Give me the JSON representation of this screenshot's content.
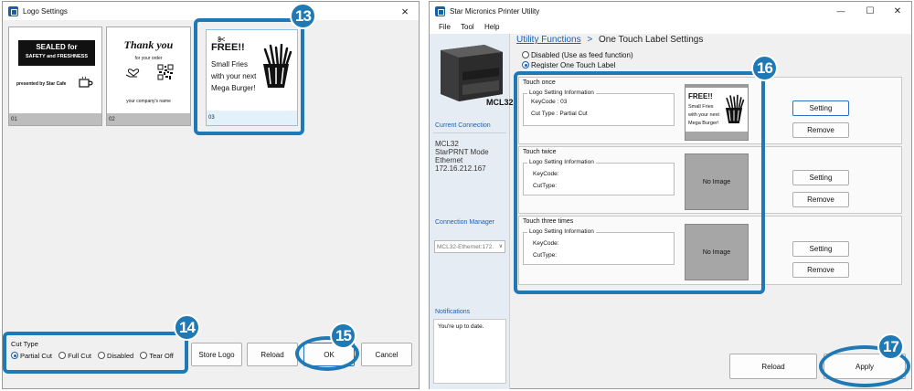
{
  "logo_window": {
    "title": "Logo Settings",
    "close": "×",
    "thumbnails": [
      {
        "index": "01",
        "line1": "SEALED for",
        "line2": "SAFETY and FRESHNESS",
        "line3": "presented by Star Cafe"
      },
      {
        "index": "02",
        "line1": "Thank you",
        "line2": "for your order",
        "line3": "your company's name"
      },
      {
        "index": "03",
        "line1": "FREE!!",
        "line2": "Small Fries",
        "line3": "with your next",
        "line4": "Mega Burger!"
      }
    ],
    "cut_type": {
      "label": "Cut Type",
      "options": [
        "Partial Cut",
        "Full Cut",
        "Disabled",
        "Tear Off"
      ],
      "selected": "Partial Cut"
    },
    "buttons": {
      "store_logo": "Store Logo",
      "reload": "Reload",
      "ok": "OK",
      "cancel": "Cancel"
    }
  },
  "utility_window": {
    "title": "Star Micronics  Printer Utility",
    "controls": {
      "minimize": "—",
      "maximize": "☐",
      "close": "✕"
    },
    "menu": [
      "File",
      "Tool",
      "Help"
    ],
    "breadcrumb": {
      "link": "Utility Functions",
      "separator": ">",
      "current": "One Touch Label Settings"
    },
    "sidebar": {
      "printer_label": "MCL32",
      "current_connection_title": "Current Connection",
      "connection_lines": [
        "MCL32",
        "StarPRNT Mode",
        "Ethernet",
        "172.16.212.167"
      ],
      "connection_manager_title": "Connection Manager",
      "connection_dropdown": "MCL32-Ethernet:172.",
      "notifications_title": "Notifications",
      "notifications_text": "You're up to date."
    },
    "mode_options": [
      {
        "label": "Disabled (Use as feed function)",
        "selected": false
      },
      {
        "label": "Register One Touch Label",
        "selected": true
      }
    ],
    "touch_groups": [
      {
        "title": "Touch once",
        "legend": "Logo Setting Information",
        "keycode_label": "KeyCode : 03",
        "cuttype_label": "Cut Type : Partial Cut",
        "preview": {
          "line1": "FREE!!",
          "line2": "Small Fries",
          "line3": "with your next",
          "line4": "Mega Burger!"
        },
        "setting": "Setting",
        "remove": "Remove"
      },
      {
        "title": "Touch twice",
        "legend": "Logo Setting Information",
        "keycode_label": "KeyCode:",
        "cuttype_label": "CutType:",
        "preview_text": "No Image",
        "setting": "Setting",
        "remove": "Remove"
      },
      {
        "title": "Touch three times",
        "legend": "Logo Setting Information",
        "keycode_label": "KeyCode:",
        "cuttype_label": "CutType:",
        "preview_text": "No Image",
        "setting": "Setting",
        "remove": "Remove"
      }
    ],
    "buttons": {
      "reload": "Reload",
      "apply": "Apply"
    }
  },
  "callouts": [
    "13",
    "14",
    "15",
    "16",
    "17"
  ],
  "colors": {
    "callout": "#1f79b4",
    "link": "#1a5fb4",
    "no_image_bg": "#a6a6a6"
  }
}
